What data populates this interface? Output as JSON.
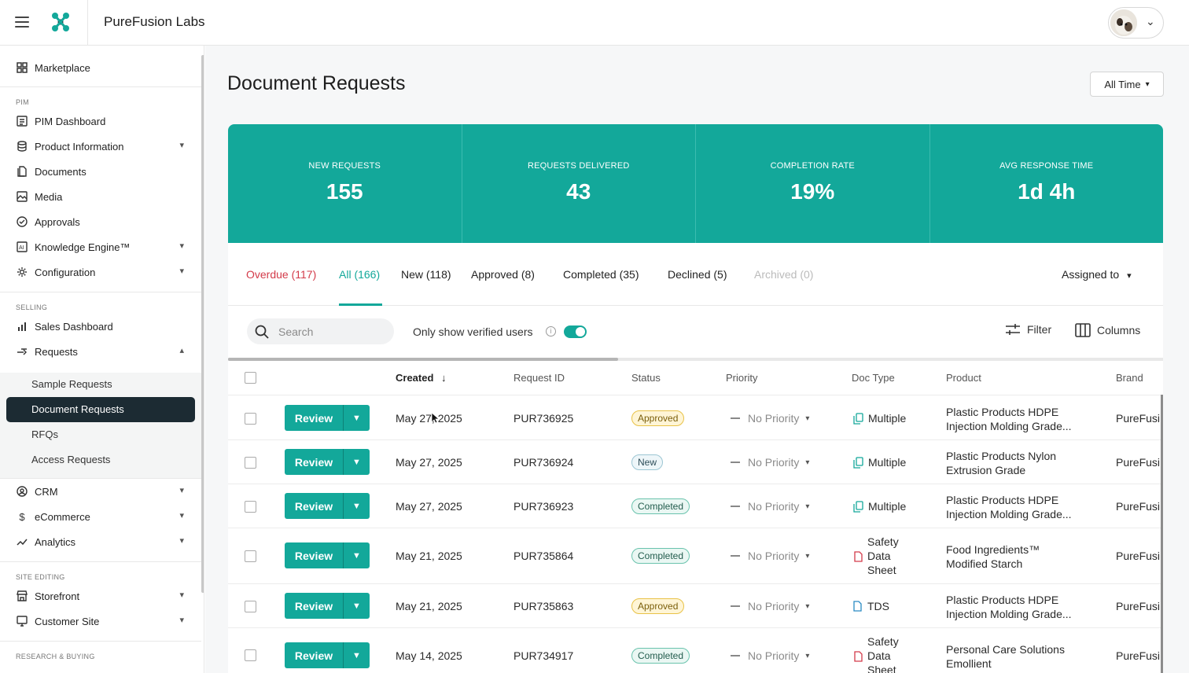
{
  "app": {
    "title": "PureFusion Labs"
  },
  "sidebar": {
    "marketplace": "Marketplace",
    "pim_section": "PIM",
    "pim_items": [
      "PIM Dashboard",
      "Product Information",
      "Documents",
      "Media",
      "Approvals",
      "Knowledge Engine™",
      "Configuration"
    ],
    "selling_section": "SELLING",
    "sales_dashboard": "Sales Dashboard",
    "requests": "Requests",
    "requests_sub": [
      "Sample Requests",
      "Document Requests",
      "RFQs",
      "Access Requests"
    ],
    "more_items": [
      "CRM",
      "eCommerce",
      "Analytics"
    ],
    "site_section": "SITE EDITING",
    "site_items": [
      "Storefront",
      "Customer Site"
    ],
    "research_section": "RESEARCH & BUYING"
  },
  "page": {
    "title": "Document Requests",
    "time_filter": "All Time"
  },
  "stats": [
    {
      "label": "NEW REQUESTS",
      "value": "155"
    },
    {
      "label": "REQUESTS DELIVERED",
      "value": "43"
    },
    {
      "label": "COMPLETION RATE",
      "value": "19%"
    },
    {
      "label": "AVG RESPONSE TIME",
      "value": "1d 4h"
    }
  ],
  "tabs": [
    "Overdue (117)",
    "All (166)",
    "New (118)",
    "Approved (8)",
    "Completed (35)",
    "Declined (5)",
    "Archived (0)"
  ],
  "assigned_to": "Assigned to",
  "toolbar": {
    "search_placeholder": "Search",
    "verified_label": "Only show verified users",
    "filter": "Filter",
    "columns": "Columns"
  },
  "table": {
    "headers": [
      "Created",
      "Request ID",
      "Status",
      "Priority",
      "Doc Type",
      "Product",
      "Brand"
    ],
    "review_label": "Review",
    "rows": [
      {
        "created": "May 27, 2025",
        "id": "PUR736925",
        "status": "Approved",
        "priority": "No Priority",
        "doc": "Multiple",
        "product": [
          "Plastic Products HDPE",
          "Injection Molding Grade..."
        ],
        "brand": "PureFusi"
      },
      {
        "created": "May 27, 2025",
        "id": "PUR736924",
        "status": "New",
        "priority": "No Priority",
        "doc": "Multiple",
        "product": [
          "Plastic Products Nylon",
          "Extrusion Grade"
        ],
        "brand": "PureFusi"
      },
      {
        "created": "May 27, 2025",
        "id": "PUR736923",
        "status": "Completed",
        "priority": "No Priority",
        "doc": "Multiple",
        "product": [
          "Plastic Products HDPE",
          "Injection Molding Grade..."
        ],
        "brand": "PureFusi"
      },
      {
        "created": "May 21, 2025",
        "id": "PUR735864",
        "status": "Completed",
        "priority": "No Priority",
        "doc": [
          "Safety",
          "Data",
          "Sheet"
        ],
        "product": [
          "Food Ingredients™",
          "Modified Starch"
        ],
        "brand": "PureFusi"
      },
      {
        "created": "May 21, 2025",
        "id": "PUR735863",
        "status": "Approved",
        "priority": "No Priority",
        "doc": "TDS",
        "product": [
          "Plastic Products HDPE",
          "Injection Molding Grade..."
        ],
        "brand": "PureFusi"
      },
      {
        "created": "May 14, 2025",
        "id": "PUR734917",
        "status": "Completed",
        "priority": "No Priority",
        "doc": [
          "Safety",
          "Data",
          "Sheet"
        ],
        "product": [
          "Personal Care Solutions",
          "Emollient"
        ],
        "brand": "PureFusi"
      }
    ]
  },
  "colors": {
    "accent": "#13a89a",
    "overdue": "#d33b4a",
    "sidebar_active": "#1c2b33"
  }
}
